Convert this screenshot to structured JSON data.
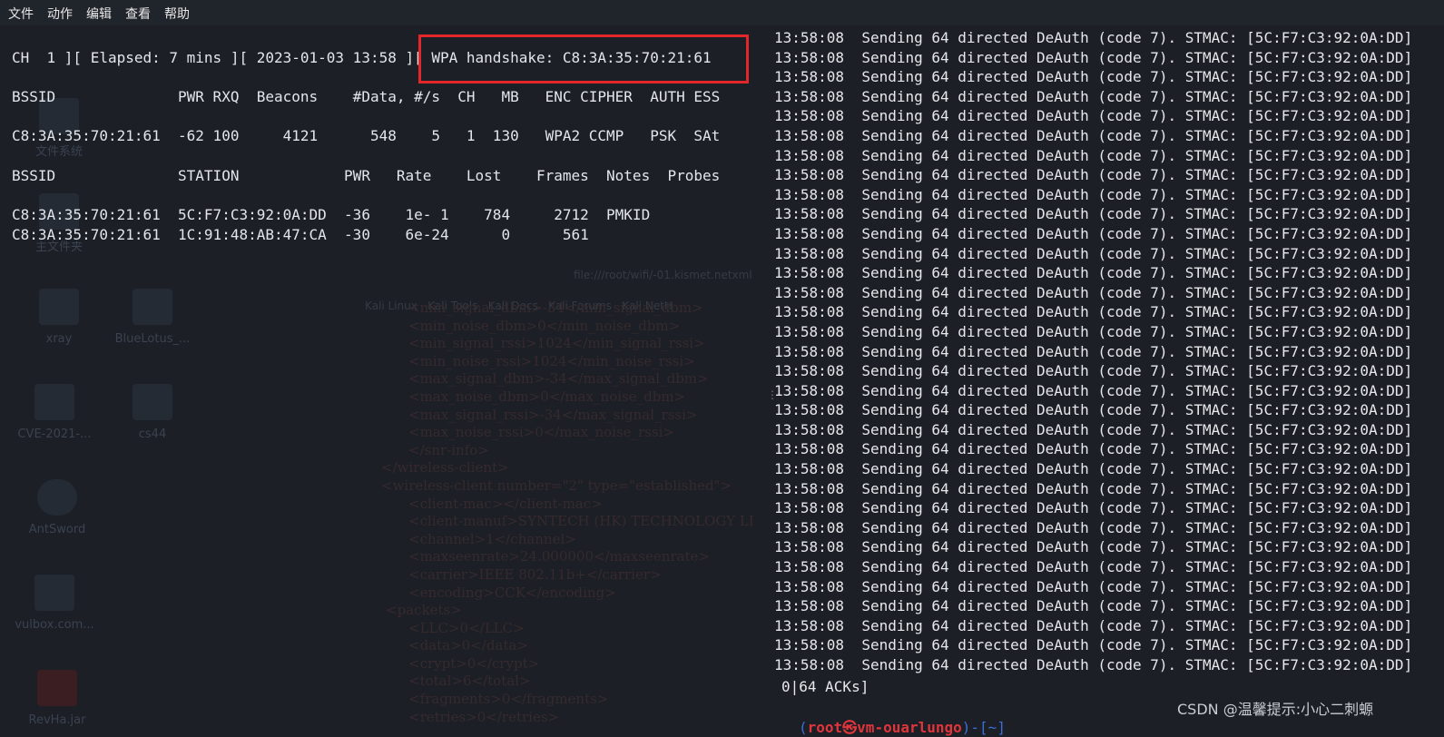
{
  "menubar": {
    "items": [
      "文件",
      "动作",
      "编辑",
      "查看",
      "帮助"
    ]
  },
  "desktop": {
    "icons": [
      "文件系统",
      "主文件夹",
      "xray",
      "BlueLotus_...",
      "CVE-2021-...",
      "cs44",
      "AntSword",
      "vulbox.com...",
      "RevHa.jar"
    ],
    "ghost_xml": [
      "<min_signal_dbm>-34</min_signal_dbm>",
      "<min_noise_dbm>0</min_noise_dbm>",
      "<min_signal_rssi>1024</min_signal_rssi>",
      "<min_noise_rssi>1024</min_noise_rssi>",
      "<max_signal_dbm>-34</max_signal_dbm>",
      "<max_noise_dbm>0</max_noise_dbm>",
      "<max_signal_rssi>-34</max_signal_rssi>",
      "<max_noise_rssi>0</max_noise_rssi>",
      "</snr-info>",
      "</wireless-client>",
      "<wireless-client number=\"2\" type=\"established\">",
      "<client-mac></client-mac>",
      "<client-manuf>SYNTECH (HK) TECHNOLOGY LI",
      "<channel>1</channel>",
      "<maxseenrate>24.000000</maxseenrate>",
      "<carrier>IEEE 802.11b+</carrier>",
      "<encoding>CCK</encoding>",
      "<packets>",
      "<LLC>0</LLC>",
      "<data>0</data>",
      "<crypt>0</crypt>",
      "<total>6</total>",
      "<fragments>0</fragments>",
      "<retries>0</retries>"
    ],
    "ghost_url": "file:///root/wifi/-01.kismet.netxml",
    "ghost_bookmarks": "Kali Linux   Kali Tools   Kali Docs   Kali Forums   Kali NetH"
  },
  "airodump": {
    "status_line": "CH  1 ][ Elapsed: 7 mins ][ 2023-01-03 13:58 ][ WPA handshake: C8:3A:35:70:21:61",
    "ap_header": "BSSID              PWR RXQ  Beacons    #Data, #/s  CH   MB   ENC CIPHER  AUTH ESS",
    "ap_row": "C8:3A:35:70:21:61  -62 100     4121      548    5   1  130   WPA2 CCMP   PSK  SAt",
    "sta_header": "BSSID              STATION            PWR   Rate    Lost    Frames  Notes  Probes",
    "sta_rows": [
      "C8:3A:35:70:21:61  5C:F7:C3:92:0A:DD  -36    1e- 1    784     2712  PMKID",
      "C8:3A:35:70:21:61  1C:91:48:AB:47:CA  -30    6e-24      0      561"
    ]
  },
  "aireplay": {
    "line": "13:58:08  Sending 64 directed DeAuth (code 7). STMAC: [5C:F7:C3:92:0A:DD]",
    "repeat_count": 33,
    "acks": "0|64 ACKs]",
    "prompt_open": "(",
    "prompt_user": "root㉿vm-ouarlungo",
    "prompt_close": ")-[~]"
  },
  "watermark": "CSDN @温馨提示:小心二刺螈",
  "colors": {
    "background": "#1c1f26",
    "highlight_box": "#e3262a",
    "prompt_user": "#e0353b",
    "prompt_bracket": "#3b6fd6"
  }
}
